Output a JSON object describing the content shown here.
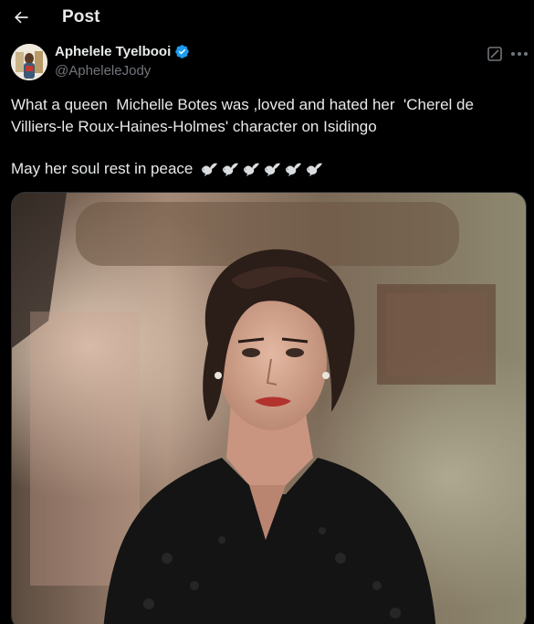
{
  "header": {
    "title": "Post",
    "back_icon": "arrow-left-icon"
  },
  "author": {
    "display_name": "Aphelele Tyelbooi",
    "handle": "@ApheleleJody",
    "verified": true,
    "verified_color": "#1d9bf0"
  },
  "tweet": {
    "text": "What a queen  Michelle Botes was ,loved and hated her  'Cherel de Villiers-le Roux-Haines-Holmes' character on Isidingo",
    "line2": "May her soul rest in peace",
    "emoji_icons": [
      "dove-icon",
      "dove-icon",
      "dove-icon",
      "dove-icon",
      "dove-icon",
      "dove-icon"
    ]
  },
  "actions": {
    "grok_icon": "grok-icon",
    "more_icon": "more-horizontal-icon"
  },
  "colors": {
    "background": "#000000",
    "text_primary": "#e7e9ea",
    "text_secondary": "#71767b",
    "accent": "#1d9bf0"
  }
}
